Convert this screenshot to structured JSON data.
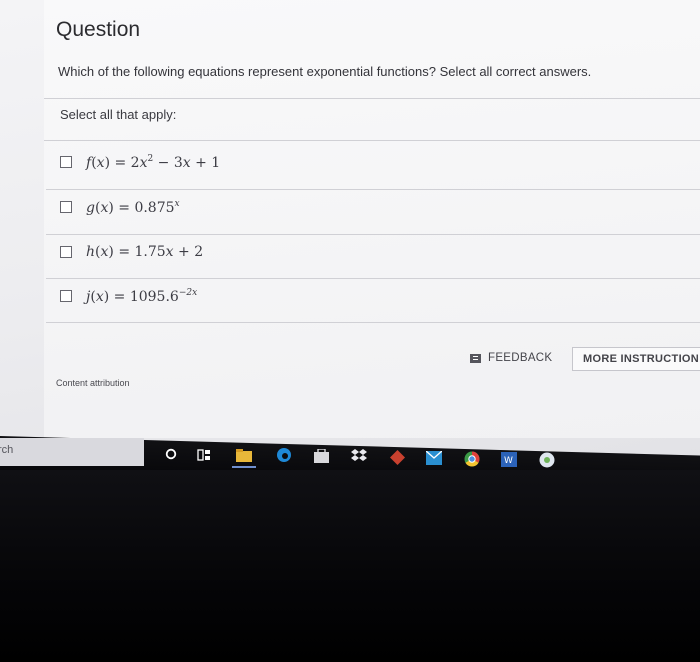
{
  "question": {
    "heading": "Question",
    "text": "Which of the following equations represent exponential functions? Select all correct answers.",
    "select_label": "Select all that apply:"
  },
  "options": [
    {
      "fn": "f",
      "var": "x",
      "parts": [
        "2",
        "x",
        "2",
        " − 3",
        "x",
        " + 1"
      ]
    },
    {
      "fn": "g",
      "var": "x",
      "base": "0.875",
      "exp": "x"
    },
    {
      "fn": "h",
      "var": "x",
      "parts": [
        "1.75",
        "x",
        " + 2"
      ]
    },
    {
      "fn": "j",
      "var": "x",
      "base": "1095.6",
      "exp": "−2x"
    }
  ],
  "buttons": {
    "feedback": "FEEDBACK",
    "more_instruction": "MORE INSTRUCTION"
  },
  "attribution": "Content attribution",
  "taskbar": {
    "search_text": "rch",
    "icons": [
      "cortana-icon",
      "task-view-icon",
      "file-explorer-icon",
      "edge-icon",
      "store-icon",
      "dropbox-icon",
      "app-icon",
      "mail-icon",
      "chrome-icon",
      "word-icon",
      "photos-icon"
    ]
  },
  "colors": {
    "text": "#2c2c30",
    "checkbox_border": "#66666e",
    "taskbar": "#0b0b0d"
  }
}
